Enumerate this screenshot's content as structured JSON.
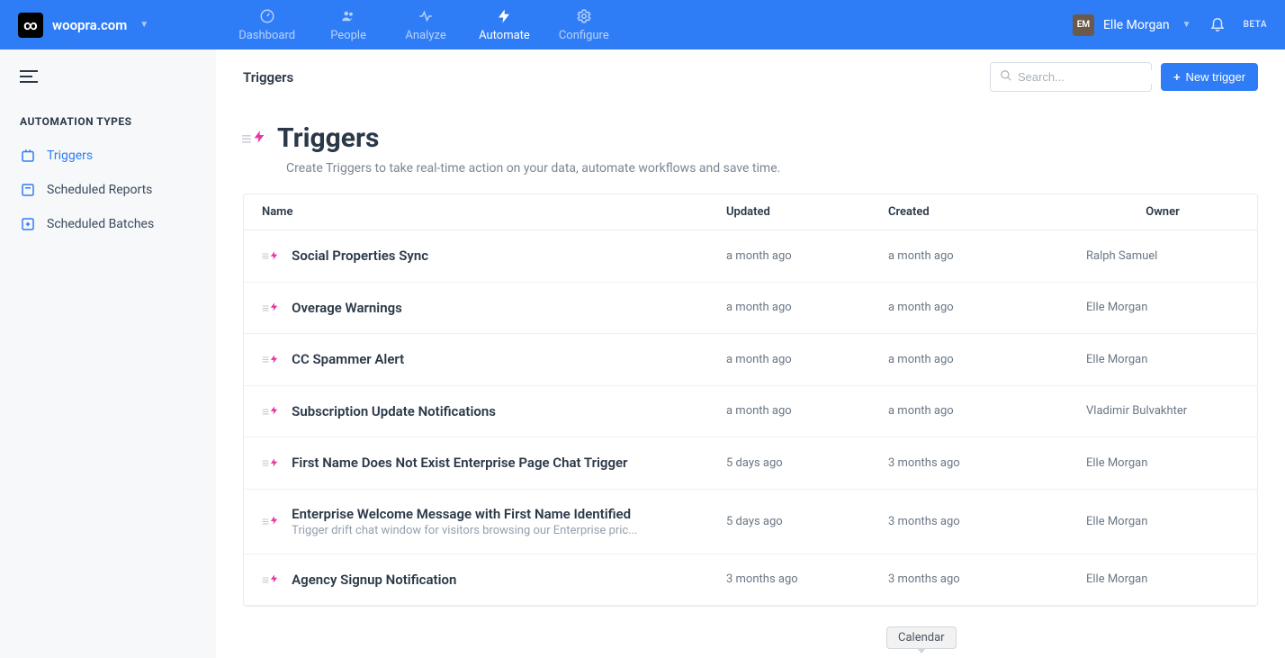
{
  "header": {
    "site": "woopra.com",
    "tabs": [
      {
        "id": "dashboard",
        "label": "Dashboard",
        "icon": "gauge-icon"
      },
      {
        "id": "people",
        "label": "People",
        "icon": "people-icon"
      },
      {
        "id": "analyze",
        "label": "Analyze",
        "icon": "pulse-icon"
      },
      {
        "id": "automate",
        "label": "Automate",
        "icon": "bolt-icon",
        "active": true
      },
      {
        "id": "configure",
        "label": "Configure",
        "icon": "gear-icon"
      }
    ],
    "user": {
      "initials": "EM",
      "name": "Elle Morgan"
    },
    "beta_label": "BETA"
  },
  "sidebar": {
    "heading": "AUTOMATION TYPES",
    "items": [
      {
        "label": "Triggers",
        "active": true
      },
      {
        "label": "Scheduled Reports",
        "active": false
      },
      {
        "label": "Scheduled Batches",
        "active": false
      }
    ]
  },
  "toolbar": {
    "breadcrumb": "Triggers",
    "search_placeholder": "Search...",
    "new_trigger_label": "New trigger"
  },
  "page": {
    "title": "Triggers",
    "subtitle": "Create Triggers to take real-time action on your data, automate workflows and save time."
  },
  "table": {
    "headers": {
      "name": "Name",
      "updated": "Updated",
      "created": "Created",
      "owner": "Owner"
    },
    "rows": [
      {
        "name": "Social Properties Sync",
        "desc": "",
        "updated": "a month ago",
        "created": "a month ago",
        "owner": "Ralph Samuel"
      },
      {
        "name": "Overage Warnings",
        "desc": "",
        "updated": "a month ago",
        "created": "a month ago",
        "owner": "Elle Morgan"
      },
      {
        "name": "CC Spammer Alert",
        "desc": "",
        "updated": "a month ago",
        "created": "a month ago",
        "owner": "Elle Morgan"
      },
      {
        "name": "Subscription Update Notifications",
        "desc": "",
        "updated": "a month ago",
        "created": "a month ago",
        "owner": "Vladimir Bulvakhter"
      },
      {
        "name": "First Name Does Not Exist Enterprise Page Chat Trigger",
        "desc": "",
        "updated": "5 days ago",
        "created": "3 months ago",
        "owner": "Elle Morgan"
      },
      {
        "name": "Enterprise Welcome Message with First Name Identified",
        "desc": "Trigger drift chat window for visitors browsing our Enterprise pric...",
        "updated": "5 days ago",
        "created": "3 months ago",
        "owner": "Elle Morgan"
      },
      {
        "name": "Agency Signup Notification",
        "desc": "",
        "updated": "3 months ago",
        "created": "3 months ago",
        "owner": "Elle Morgan"
      }
    ]
  },
  "tooltip": {
    "calendar": "Calendar"
  }
}
